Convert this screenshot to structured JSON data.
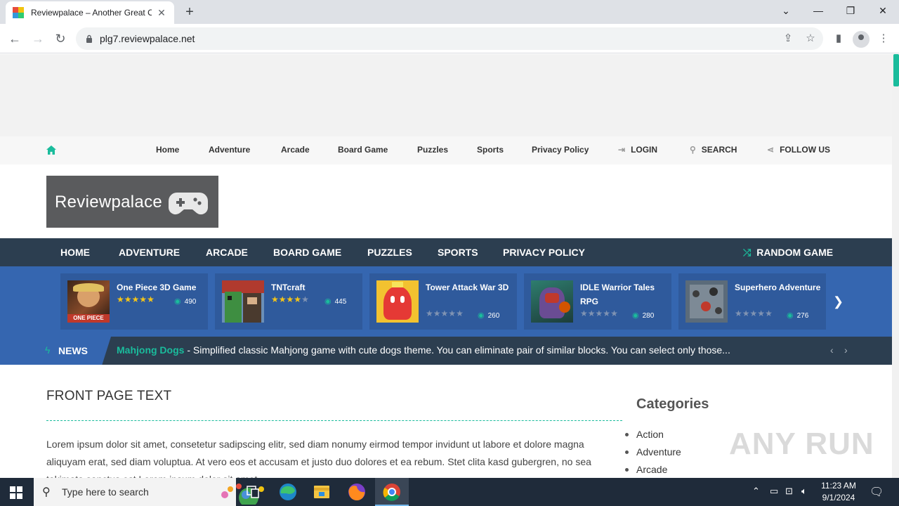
{
  "browser": {
    "tab_title": "Reviewpalace – Another Great O",
    "url": "plg7.reviewpalace.net"
  },
  "topnav": {
    "items": [
      "Home",
      "Adventure",
      "Arcade",
      "Board Game",
      "Puzzles",
      "Sports",
      "Privacy Policy"
    ],
    "login": "LOGIN",
    "search": "SEARCH",
    "follow": "FOLLOW US"
  },
  "logo": {
    "text": "Reviewpalace"
  },
  "mainnav": {
    "items": [
      "HOME",
      "ADVENTURE",
      "ARCADE",
      "BOARD GAME",
      "PUZZLES",
      "SPORTS",
      "PRIVACY POLICY"
    ],
    "random": "RANDOM GAME"
  },
  "carousel": {
    "games": [
      {
        "title": "One Piece 3D Game",
        "rating": 5,
        "plays": "490",
        "thumb_label": "ONE PIECE"
      },
      {
        "title": "TNTcraft",
        "rating": 4,
        "plays": "445"
      },
      {
        "title": "Tower Attack War 3D",
        "rating": 0,
        "plays": "260"
      },
      {
        "title": "IDLE Warrior Tales RPG",
        "rating": 0,
        "plays": "280"
      },
      {
        "title": "Superhero Adventure",
        "rating": 0,
        "plays": "276"
      }
    ]
  },
  "news": {
    "label": "NEWS",
    "headline": "Mahjong Dogs",
    "text": " - Simplified classic Mahjong game with cute dogs theme. You can eliminate pair of similar blocks. You can select only those..."
  },
  "content": {
    "title": "FRONT PAGE TEXT",
    "body": "Lorem ipsum dolor sit amet, consetetur sadipscing elitr, sed diam nonumy eirmod tempor invidunt ut labore et dolore magna aliquyam erat, sed diam voluptua. At vero eos et accusam et justo duo dolores et ea rebum. Stet clita kasd gubergren, no sea takimata sanctus est Lorem ipsum dolor sit amet."
  },
  "sidebar": {
    "title": "Categories",
    "categories": [
      "Action",
      "Adventure",
      "Arcade"
    ]
  },
  "watermark": "ANY RUN",
  "taskbar": {
    "search_placeholder": "Type here to search",
    "time": "11:23 AM",
    "date": "9/1/2024"
  },
  "colors": {
    "accent": "#1abc9c",
    "nav_dark": "#2c3e50",
    "carousel_blue": "#3566b0",
    "star_gold": "#f5c518"
  },
  "icons": [
    "home-icon",
    "login-icon",
    "search-icon",
    "share-icon",
    "shuffle-icon",
    "gamepad-icon",
    "bolt-icon",
    "eye-icon",
    "star-icon",
    "chevron-right-icon",
    "chevron-left-icon"
  ]
}
